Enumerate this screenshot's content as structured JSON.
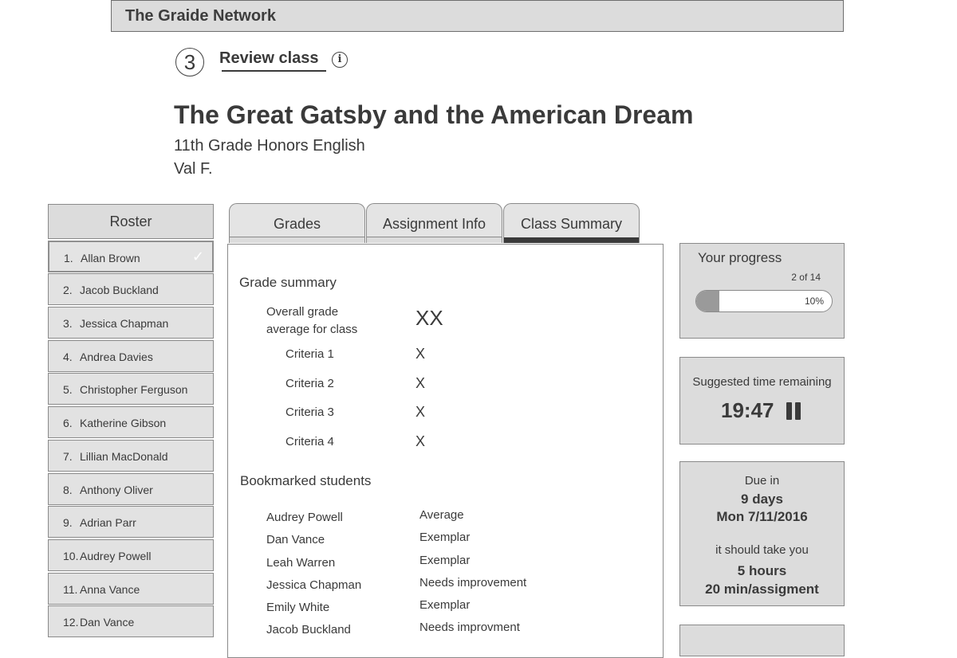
{
  "app": {
    "brand": "The Graide Network"
  },
  "step": {
    "number": "3",
    "title": "Review class",
    "info_icon": "i"
  },
  "assignment": {
    "title": "The Great Gatsby and the American Dream",
    "course": "11th Grade Honors English",
    "teacher": "Val F."
  },
  "roster": {
    "header": "Roster",
    "active_index": 0,
    "items": [
      {
        "num": "1.",
        "name": "Allan Brown",
        "check": "✓"
      },
      {
        "num": "2.",
        "name": "Jacob Buckland"
      },
      {
        "num": "3.",
        "name": "Jessica Chapman"
      },
      {
        "num": "4.",
        "name": "Andrea Davies"
      },
      {
        "num": "5.",
        "name": "Christopher Ferguson"
      },
      {
        "num": "6.",
        "name": "Katherine  Gibson"
      },
      {
        "num": "7.",
        "name": "Lillian MacDonald"
      },
      {
        "num": "8.",
        "name": "Anthony Oliver"
      },
      {
        "num": "9.",
        "name": "Adrian Parr"
      },
      {
        "num": "10.",
        "name": "Audrey Powell"
      },
      {
        "num": "11.",
        "name": "Anna Vance"
      },
      {
        "num": "12.",
        "name": "Dan Vance"
      }
    ]
  },
  "tabs": [
    {
      "label": "Grades"
    },
    {
      "label": "Assignment Info"
    },
    {
      "label": "Class Summary"
    }
  ],
  "active_tab": 2,
  "summary": {
    "grade_title": "Grade summary",
    "overall_label_1": "Overall grade",
    "overall_label_2": "average for class",
    "overall_value": "XX",
    "criteria": [
      {
        "label": "Criteria 1",
        "value": "X"
      },
      {
        "label": "Criteria 2",
        "value": "X"
      },
      {
        "label": "Criteria 3",
        "value": "X"
      },
      {
        "label": "Criteria 4",
        "value": "X"
      }
    ],
    "bookmarked_title": "Bookmarked students",
    "bookmarked": [
      {
        "name": "Audrey Powell",
        "rating": "Average"
      },
      {
        "name": "Dan Vance",
        "rating": "Exemplar"
      },
      {
        "name": "Leah Warren",
        "rating": "Exemplar"
      },
      {
        "name": "Jessica Chapman",
        "rating": "Needs improvement"
      },
      {
        "name": "Emily White",
        "rating": "Exemplar"
      },
      {
        "name": "Jacob Buckland",
        "rating": "Needs improvment"
      }
    ]
  },
  "progress": {
    "title": "Your progress",
    "count": "2 of 14",
    "percent_label": "10%",
    "fraction": 0.17
  },
  "timer": {
    "label": "Suggested time remaining",
    "value": "19:47"
  },
  "due": {
    "label": "Due in",
    "days": "9 days",
    "date": "Mon 7/11/2016",
    "effort_label": "it should take you",
    "hours": "5 hours",
    "per_assignment": "20 min/assigment"
  }
}
